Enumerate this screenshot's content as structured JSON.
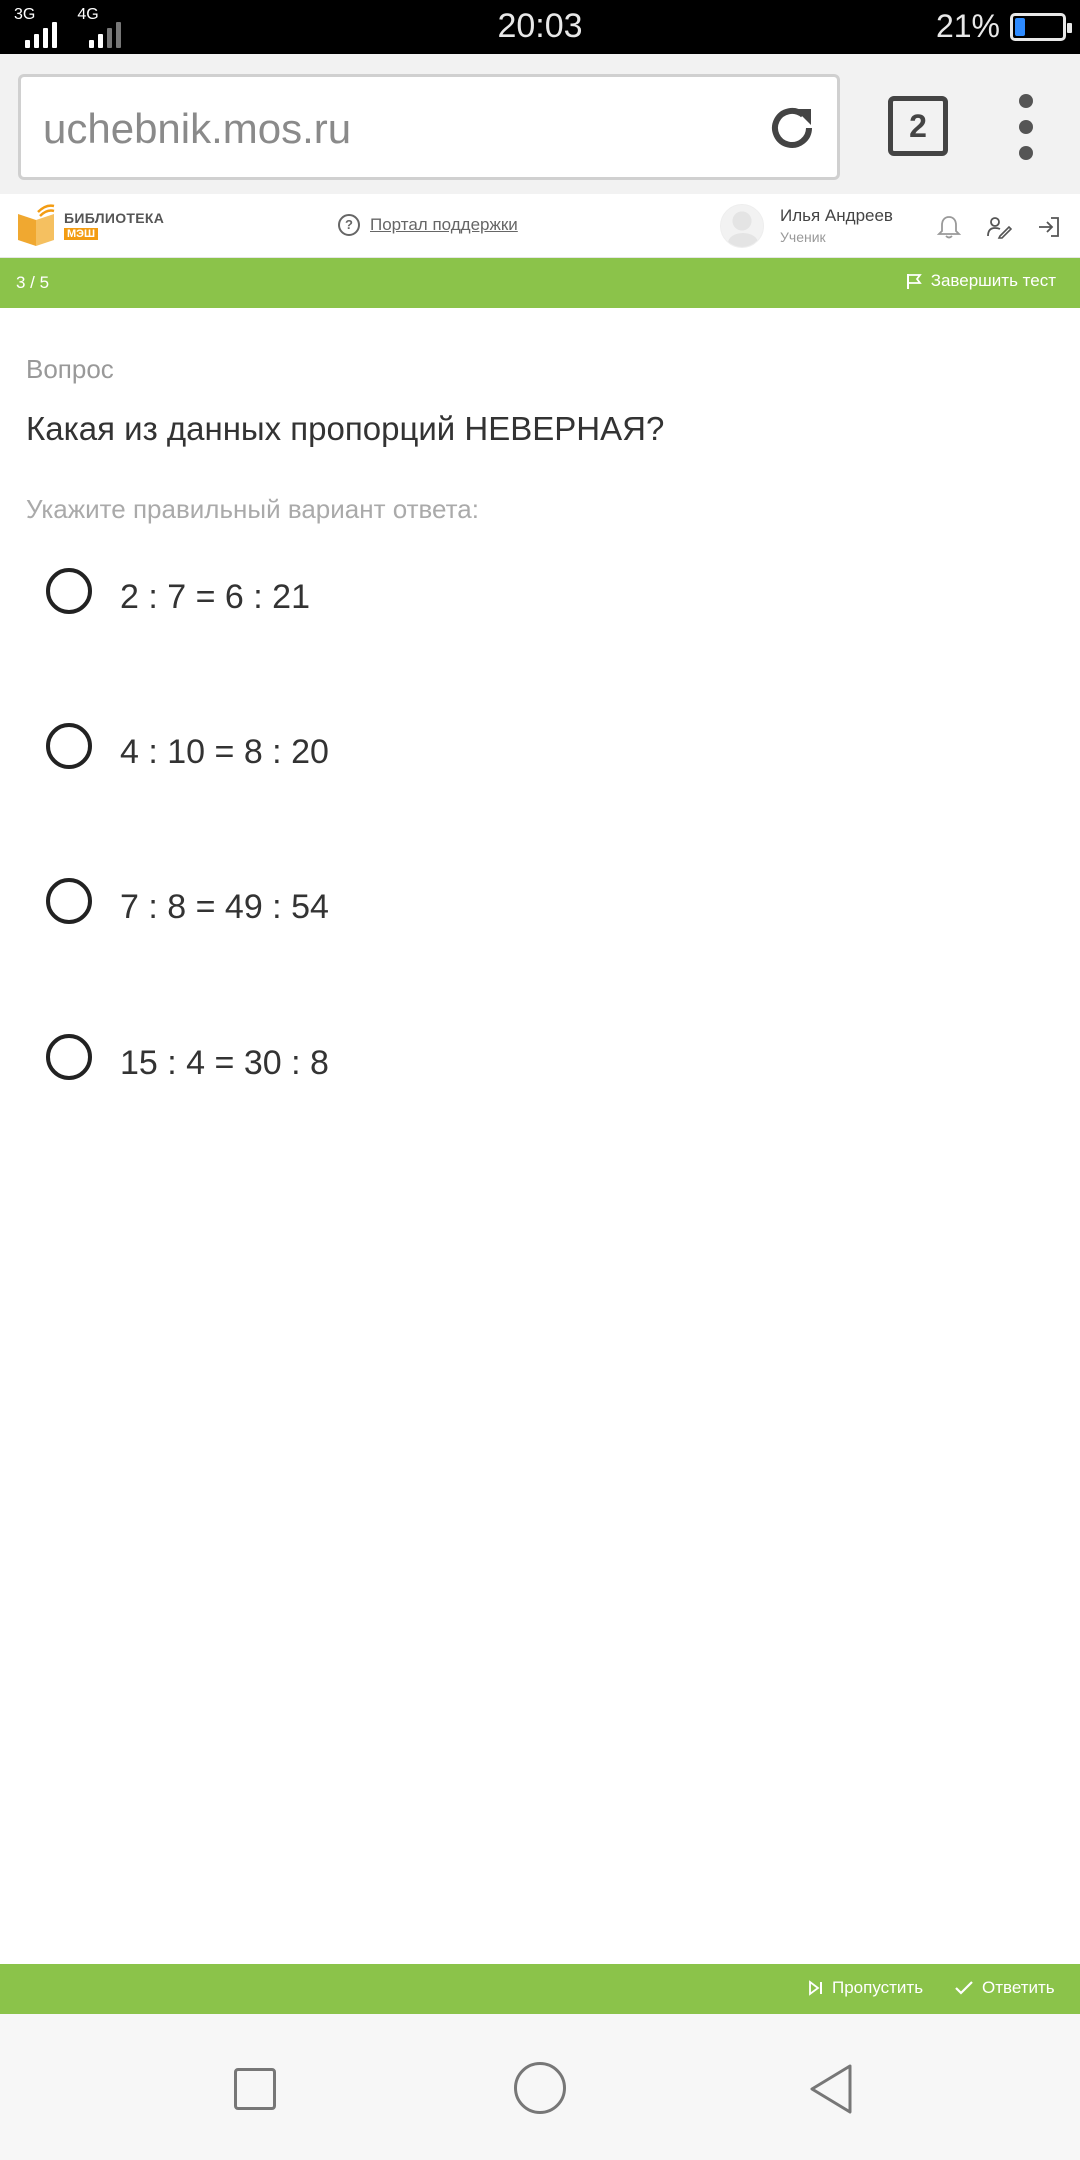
{
  "status_bar": {
    "network_1": "3G",
    "network_2": "4G",
    "time": "20:03",
    "battery": "21%",
    "battery_level": 0.21
  },
  "browser": {
    "url": "uchebnik.mos.ru",
    "tab_count": "2"
  },
  "site_header": {
    "logo_title": "БИБЛИОТЕКА",
    "logo_sub": "МЭШ",
    "support_label": "Портал поддержки",
    "user_name": "Илья Андреев",
    "user_role": "Ученик"
  },
  "progress": {
    "label": "3 / 5",
    "finish_label": "Завершить тест"
  },
  "question": {
    "label": "Вопрос",
    "text": "Какая из данных пропорций НЕВЕРНАЯ?",
    "hint": "Укажите правильный вариант ответа:",
    "options": [
      {
        "text": "2 : 7 = 6 : 21",
        "selected": false
      },
      {
        "text": "4 : 10 = 8 : 20",
        "selected": false
      },
      {
        "text": "7 : 8 = 49 : 54",
        "selected": false
      },
      {
        "text": "15 : 4 = 30 : 8",
        "selected": false
      }
    ]
  },
  "footer": {
    "skip_label": "Пропустить",
    "answer_label": "Ответить"
  },
  "colors": {
    "accent_green": "#8bc34a",
    "logo_orange": "#f39c12"
  }
}
